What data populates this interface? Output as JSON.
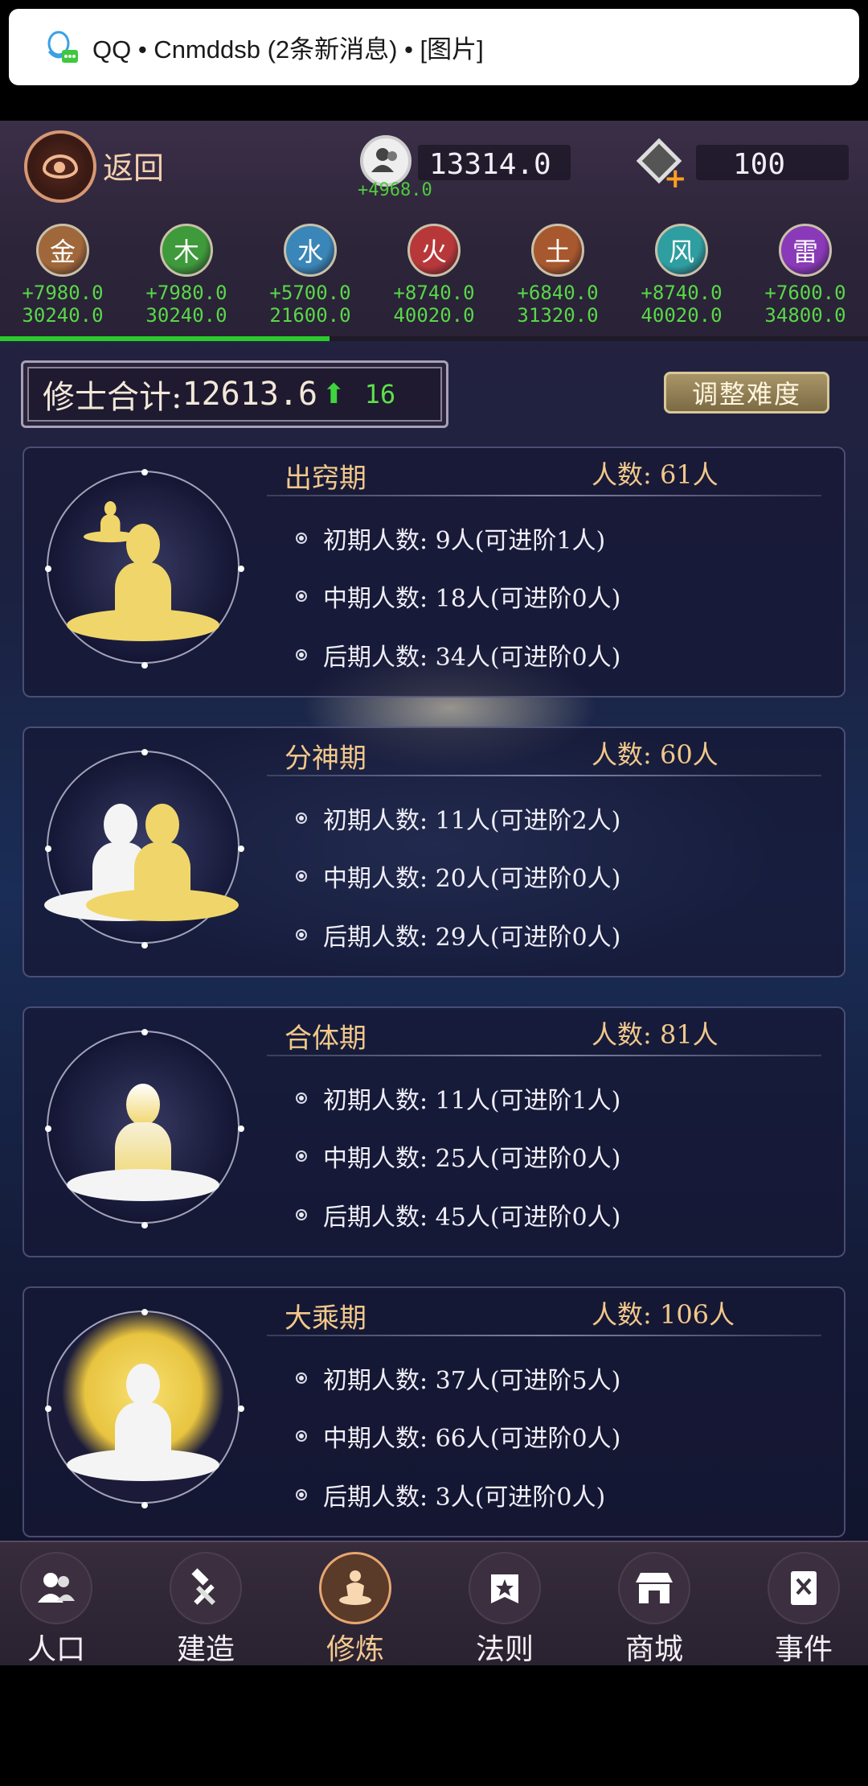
{
  "notification": {
    "text": "QQ • Cnmddsb (2条新消息) • [图片]"
  },
  "header": {
    "back_label": "返回",
    "population": {
      "value": "13314.0",
      "delta": "+4968.0"
    },
    "gems": {
      "value": "100"
    }
  },
  "elements": [
    {
      "name": "金",
      "gain": "+7980.0",
      "total": "30240.0",
      "color": "#a0683a"
    },
    {
      "name": "木",
      "gain": "+7980.0",
      "total": "30240.0",
      "color": "#3e9a3a"
    },
    {
      "name": "水",
      "gain": "+5700.0",
      "total": "21600.0",
      "color": "#3a86b8"
    },
    {
      "name": "火",
      "gain": "+8740.0",
      "total": "40020.0",
      "color": "#b8383a"
    },
    {
      "name": "土",
      "gain": "+6840.0",
      "total": "31320.0",
      "color": "#a8582e"
    },
    {
      "name": "风",
      "gain": "+8740.0",
      "total": "40020.0",
      "color": "#2e9ea0"
    },
    {
      "name": "雷",
      "gain": "+7600.0",
      "total": "34800.0",
      "color": "#8a3ab8"
    }
  ],
  "progress_fraction": 0.38,
  "stats": {
    "label": "修士合计:",
    "value": "12613.6",
    "arrow": "⬆",
    "count": "16"
  },
  "adjust_button": "调整难度",
  "realms": [
    {
      "name": "出窍期",
      "count": "人数: 61人",
      "stages": [
        "初期人数: 9人(可进阶1人)",
        "中期人数: 18人(可进阶0人)",
        "后期人数: 34人(可进阶0人)"
      ]
    },
    {
      "name": "分神期",
      "count": "人数: 60人",
      "stages": [
        "初期人数: 11人(可进阶2人)",
        "中期人数: 20人(可进阶0人)",
        "后期人数: 29人(可进阶0人)"
      ]
    },
    {
      "name": "合体期",
      "count": "人数: 81人",
      "stages": [
        "初期人数: 11人(可进阶1人)",
        "中期人数: 25人(可进阶0人)",
        "后期人数: 45人(可进阶0人)"
      ]
    },
    {
      "name": "大乘期",
      "count": "人数: 106人",
      "stages": [
        "初期人数: 37人(可进阶5人)",
        "中期人数: 66人(可进阶0人)",
        "后期人数: 3人(可进阶0人)"
      ]
    }
  ],
  "nav": [
    {
      "label": "人口",
      "icon": "people-icon"
    },
    {
      "label": "建造",
      "icon": "hammer-wrench-icon"
    },
    {
      "label": "修炼",
      "icon": "meditation-icon",
      "active": true
    },
    {
      "label": "法则",
      "icon": "scroll-star-icon"
    },
    {
      "label": "商城",
      "icon": "shop-icon"
    },
    {
      "label": "事件",
      "icon": "book-icon"
    }
  ]
}
